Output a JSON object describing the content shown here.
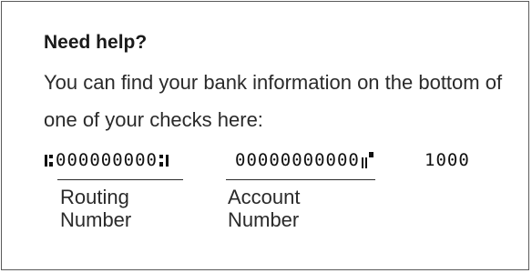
{
  "help": {
    "title": "Need help?",
    "description": "You can find your bank information on the bottom of one of your checks here:"
  },
  "micr_line": {
    "routing_digits": "000000000",
    "account_digits": "00000000000",
    "check_number": "1000",
    "transit_symbol": "transit-symbol",
    "on_us_symbol": "on-us-symbol"
  },
  "labels": {
    "routing": [
      "Routing",
      "Number"
    ],
    "account": [
      "Account",
      "Number"
    ]
  }
}
